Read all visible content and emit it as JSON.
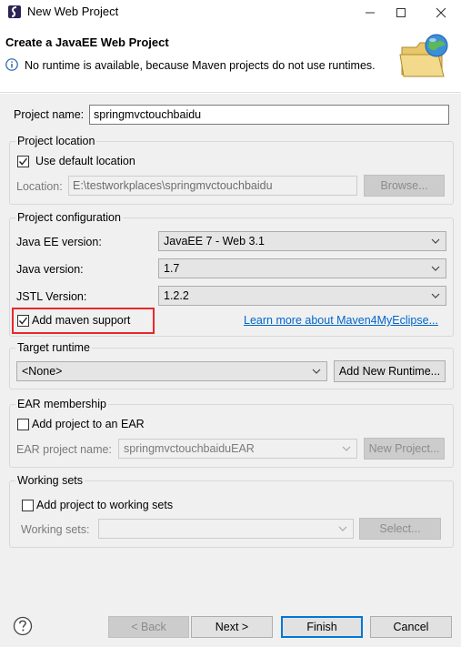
{
  "window": {
    "title": "New Web Project",
    "icons": {
      "app": "eclipse-icon",
      "minimize": "minimize-icon",
      "maximize": "maximize-icon",
      "close": "close-icon"
    }
  },
  "banner": {
    "title": "Create a JavaEE Web Project",
    "message": "No runtime is available, because Maven projects do not use runtimes.",
    "info_icon": "info-icon",
    "graphic_icon": "folder-globe-icon"
  },
  "project_name": {
    "label": "Project name:",
    "value": "springmvctouchbaidu"
  },
  "project_location": {
    "legend": "Project location",
    "use_default_label": "Use default location",
    "use_default_checked": true,
    "location_label": "Location:",
    "location_value": "E:\\testworkplaces\\springmvctouchbaidu",
    "browse_label": "Browse..."
  },
  "project_configuration": {
    "legend": "Project configuration",
    "javaee_label": "Java EE version:",
    "javaee_value": "JavaEE 7 - Web 3.1",
    "java_label": "Java version:",
    "java_value": "1.7",
    "jstl_label": "JSTL Version:",
    "jstl_value": "1.2.2",
    "maven_label": "Add maven support",
    "maven_checked": true,
    "maven_link": "Learn more about Maven4MyEclipse..."
  },
  "target_runtime": {
    "legend": "Target runtime",
    "value": "<None>",
    "new_runtime_label": "Add New Runtime..."
  },
  "ear_membership": {
    "legend": "EAR membership",
    "add_label": "Add project to an EAR",
    "add_checked": false,
    "ear_name_label": "EAR project name:",
    "ear_name_value": "springmvctouchbaiduEAR",
    "new_project_label": "New Project..."
  },
  "working_sets": {
    "legend": "Working sets",
    "add_label": "Add project to working sets",
    "add_checked": false,
    "sets_label": "Working sets:",
    "sets_value": "",
    "select_label": "Select..."
  },
  "footer": {
    "help_icon": "help-icon",
    "back_label": "< Back",
    "next_label": "Next >",
    "finish_label": "Finish",
    "cancel_label": "Cancel"
  },
  "colors": {
    "accent": "#0078d7",
    "highlight_box": "#e8282a",
    "link": "#0066cc",
    "dialog_bg": "#f0f0f0"
  }
}
